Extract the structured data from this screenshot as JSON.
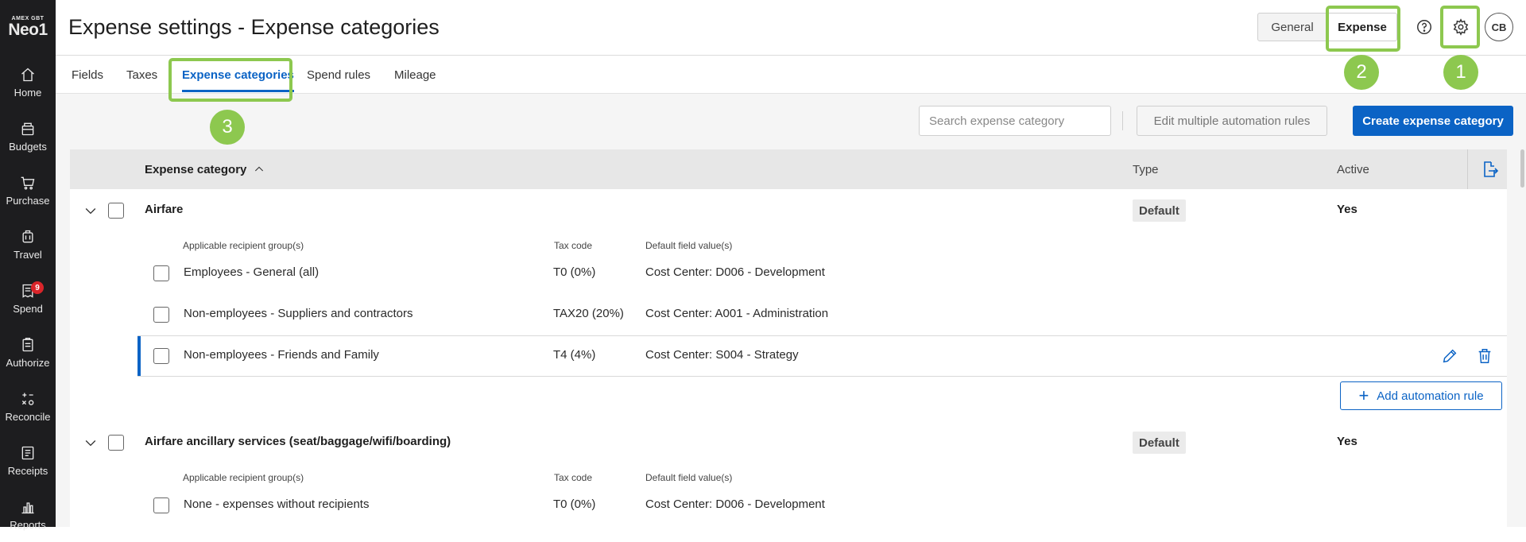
{
  "sidebar": {
    "brand_sub": "AMEX GBT",
    "brand_main": "Neo1",
    "items": [
      {
        "label": "Home",
        "icon": "home-icon"
      },
      {
        "label": "Budgets",
        "icon": "budgets-icon"
      },
      {
        "label": "Purchase",
        "icon": "cart-icon"
      },
      {
        "label": "Travel",
        "icon": "luggage-icon"
      },
      {
        "label": "Spend",
        "icon": "receipt-icon",
        "badge": "9"
      },
      {
        "label": "Authorize",
        "icon": "clipboard-icon"
      },
      {
        "label": "Reconcile",
        "icon": "calculator-icon"
      },
      {
        "label": "Receipts",
        "icon": "receipts-icon"
      },
      {
        "label": "Reports",
        "icon": "bar-chart-icon"
      }
    ]
  },
  "header": {
    "title": "Expense settings - Expense categories",
    "seg_general": "General",
    "seg_expense": "Expense",
    "avatar": "CB"
  },
  "annotations": {
    "n1": "1",
    "n2": "2",
    "n3": "3"
  },
  "tabs": [
    {
      "label": "Fields"
    },
    {
      "label": "Taxes"
    },
    {
      "label": "Expense categories",
      "active": true
    },
    {
      "label": "Spend rules"
    },
    {
      "label": "Mileage"
    }
  ],
  "toolbar": {
    "search_placeholder": "Search expense category",
    "edit_multiple": "Edit multiple automation rules",
    "create": "Create expense category"
  },
  "table": {
    "col_category": "Expense category",
    "col_type": "Type",
    "col_active": "Active",
    "sub_col_groups": "Applicable recipient group(s)",
    "sub_col_tax": "Tax code",
    "sub_col_default": "Default field value(s)",
    "add_rule": "Add automation rule",
    "groups": [
      {
        "name": "Airfare",
        "type": "Default",
        "active": "Yes",
        "rows": [
          {
            "group": "Employees - General (all)",
            "tax": "T0 (0%)",
            "default": "Cost Center: D006 - Development"
          },
          {
            "group": "Non-employees - Suppliers and contractors",
            "tax": "TAX20 (20%)",
            "default": "Cost Center: A001 - Administration"
          },
          {
            "group": "Non-employees - Friends and Family",
            "tax": "T4 (4%)",
            "default": "Cost Center: S004 - Strategy"
          }
        ]
      },
      {
        "name": "Airfare ancillary services (seat/baggage/wifi/boarding)",
        "type": "Default",
        "active": "Yes",
        "rows": [
          {
            "group": "None - expenses without recipients",
            "tax": "T0 (0%)",
            "default": "Cost Center: D006 - Development"
          }
        ]
      }
    ]
  },
  "colors": {
    "accent": "#0b63c5",
    "highlight": "#8dc84f",
    "sidebar_bg": "#1d1d1f",
    "badge": "#d9252a"
  }
}
